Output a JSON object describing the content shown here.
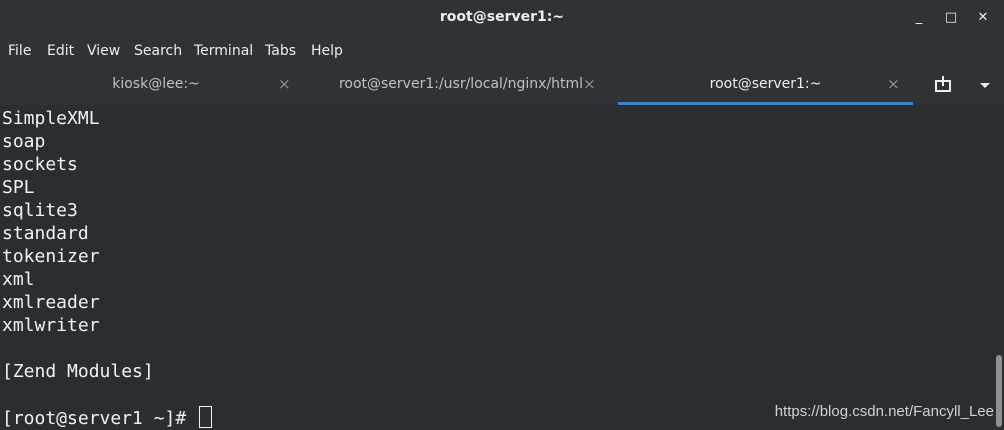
{
  "window": {
    "title": "root@server1:~",
    "controls": {
      "minimize_icon": "_",
      "maximize_icon": "□",
      "close_icon": "✕"
    }
  },
  "menubar": {
    "items": [
      "File",
      "Edit",
      "View",
      "Search",
      "Terminal",
      "Tabs",
      "Help"
    ]
  },
  "tabs": [
    {
      "label": "kiosk@lee:~",
      "active": false
    },
    {
      "label": "root@server1:/usr/local/nginx/html",
      "active": false
    },
    {
      "label": "root@server1:~",
      "active": true
    }
  ],
  "tab_close_glyph": "×",
  "terminal": {
    "lines": [
      "SimpleXML",
      "soap",
      "sockets",
      "SPL",
      "sqlite3",
      "standard",
      "tokenizer",
      "xml",
      "xmlreader",
      "xmlwriter",
      "",
      "[Zend Modules]",
      "",
      "[root@server1 ~]# "
    ]
  },
  "watermark": "https://blog.csdn.net/Fancyll_Lee",
  "colors": {
    "background": "#2b2e30",
    "chrome": "#2f3335",
    "text": "#f2f2f2",
    "accent": "#3d7fc5"
  }
}
